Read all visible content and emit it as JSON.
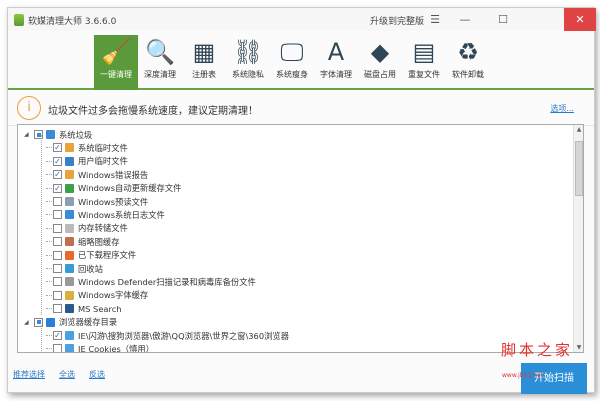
{
  "window": {
    "title": "软媒清理大师 3.6.6.0",
    "upgrade": "升级到完整版",
    "menu": "☰",
    "minimize": "—",
    "maximize": "☐",
    "close": "✕"
  },
  "toolbar": [
    {
      "label": "一键清理",
      "icon": "broom-icon",
      "glyph": "🧹",
      "active": true
    },
    {
      "label": "深度清理",
      "icon": "magnifier-icon",
      "glyph": "🔍"
    },
    {
      "label": "注册表",
      "icon": "registry-blocks-icon",
      "glyph": "▦"
    },
    {
      "label": "系统隐私",
      "icon": "privacy-link-icon",
      "glyph": "⛓"
    },
    {
      "label": "系统瘦身",
      "icon": "monitor-icon",
      "glyph": "🖵"
    },
    {
      "label": "字体清理",
      "icon": "font-icon",
      "glyph": "A"
    },
    {
      "label": "磁盘占用",
      "icon": "disk-icon",
      "glyph": "◆"
    },
    {
      "label": "重复文件",
      "icon": "duplicate-grid-icon",
      "glyph": "▤"
    },
    {
      "label": "软件卸载",
      "icon": "recycle-icon",
      "glyph": "♻"
    }
  ],
  "notice": {
    "icon": "i",
    "text": "垃圾文件过多会拖慢系统速度，建议定期清理！",
    "options": "选项..."
  },
  "tree": [
    {
      "label": "系统垃圾",
      "level": 0,
      "state": "partial",
      "color": "#3a8ad8"
    },
    {
      "label": "系统临时文件",
      "level": 1,
      "state": "checked",
      "color": "#e8a33a"
    },
    {
      "label": "用户临时文件",
      "level": 1,
      "state": "checked",
      "color": "#3a7fc8"
    },
    {
      "label": "Windows错误报告",
      "level": 1,
      "state": "checked",
      "color": "#e8a33a"
    },
    {
      "label": "Windows自动更新缓存文件",
      "level": 1,
      "state": "checked",
      "color": "#3aa04a"
    },
    {
      "label": "Windows预读文件",
      "level": 1,
      "state": "unchecked",
      "color": "#8aa0b0"
    },
    {
      "label": "Windows系统日志文件",
      "level": 1,
      "state": "unchecked",
      "color": "#3a8ad8"
    },
    {
      "label": "内存转储文件",
      "level": 1,
      "state": "unchecked",
      "color": "#bbbbbb"
    },
    {
      "label": "缩略图缓存",
      "level": 1,
      "state": "unchecked",
      "color": "#c07050"
    },
    {
      "label": "已下载程序文件",
      "level": 1,
      "state": "unchecked",
      "color": "#e86a2a"
    },
    {
      "label": "回收站",
      "level": 1,
      "state": "unchecked",
      "color": "#3a9ad8"
    },
    {
      "label": "Windows Defender扫描记录和病毒库备份文件",
      "level": 1,
      "state": "unchecked",
      "color": "#999999"
    },
    {
      "label": "Windows字体缓存",
      "level": 1,
      "state": "unchecked",
      "color": "#d8b040"
    },
    {
      "label": "MS Search",
      "level": 1,
      "state": "unchecked",
      "color": "#2a5a8a"
    },
    {
      "label": "浏览器缓存目录",
      "level": 0,
      "state": "partial",
      "color": "#2a7ed8"
    },
    {
      "label": "IE\\闪游\\搜狗浏览器\\傲游\\QQ浏览器\\世界之窗\\360浏览器",
      "level": 1,
      "state": "checked",
      "color": "#4aa0e0"
    },
    {
      "label": "IE Cookies（慎用）",
      "level": 1,
      "state": "unchecked",
      "color": "#4aa0e0"
    }
  ],
  "footer": {
    "recommended": "推荐选择",
    "select_all": "全选",
    "invert": "反选",
    "scan": "开始扫描"
  },
  "watermark": {
    "text": "脚本之家",
    "url": "www.jb51.net"
  }
}
